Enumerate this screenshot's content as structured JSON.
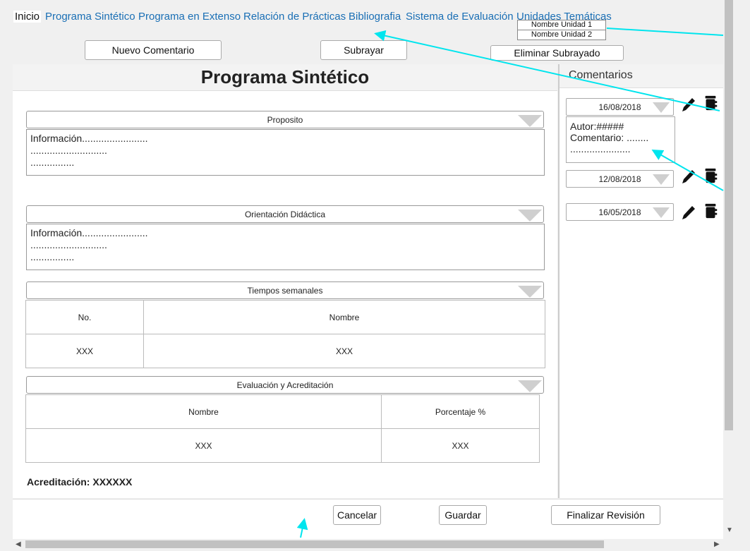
{
  "nav": {
    "items": [
      "Inicio",
      "Programa Sintético",
      "Programa en Extenso",
      "Relación de Prácticas",
      "Bibliografia",
      "Sistema de Evaluación",
      "Unidades Temáticas"
    ],
    "units_dropdown": [
      "Nombre Unidad 1",
      "Nombre Unidad 2"
    ]
  },
  "toolbar": {
    "new_comment": "Nuevo Comentario",
    "underline": "Subrayar",
    "remove_underline": "Eliminar Subrayado"
  },
  "main": {
    "title": "Programa Sintético",
    "sections": [
      {
        "header": "Proposito",
        "lines": [
          "Información........................",
          "............................",
          "................"
        ]
      },
      {
        "header": "Orientación Didáctica",
        "lines": [
          "Información........................",
          "............................",
          "................"
        ]
      }
    ],
    "tiempos": {
      "header": "Tiempos semanales",
      "columns": [
        "No.",
        "Nombre"
      ],
      "row": [
        "XXX",
        "XXX"
      ]
    },
    "evaluacion": {
      "header": "Evaluación y Acreditación",
      "columns": [
        "Nombre",
        "Porcentaje %"
      ],
      "row": [
        "XXX",
        "XXX"
      ]
    },
    "acreditacion": "Acreditación: XXXXXX"
  },
  "comments": {
    "title": "Comentarios",
    "dates": [
      "16/08/2018",
      "12/08/2018",
      "16/05/2018"
    ],
    "expanded": {
      "author": "Autor:#####",
      "comment": "Comentario: ........",
      "extra": "......................"
    }
  },
  "footer": {
    "cancel": "Cancelar",
    "save": "Guardar",
    "finish": "Finalizar Revisión"
  },
  "colors": {
    "link": "#1a6fb5",
    "annotation": "#00e5ee"
  }
}
